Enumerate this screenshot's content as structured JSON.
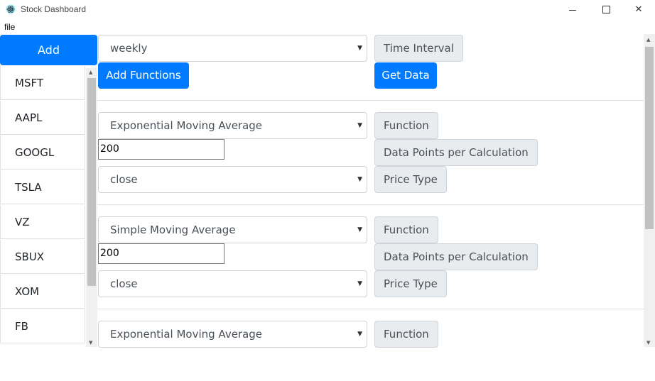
{
  "window": {
    "title": "Stock Dashboard",
    "icon": "electron-atom-icon",
    "min_glyph": "",
    "close_glyph": "✕"
  },
  "menu": {
    "file": "file"
  },
  "sidebar": {
    "add_label": "Add",
    "tickers": [
      "MSFT",
      "AAPL",
      "GOOGL",
      "TSLA",
      "VZ",
      "SBUX",
      "XOM",
      "FB"
    ]
  },
  "header": {
    "interval_value": "weekly",
    "interval_label": "Time Interval",
    "add_functions_label": "Add Functions",
    "get_data_label": "Get Data"
  },
  "functions": [
    {
      "function_value": "Exponential Moving Average",
      "function_label": "Function",
      "points_value": "200",
      "points_label": "Data Points per Calculation",
      "price_value": "close",
      "price_label": "Price Type"
    },
    {
      "function_value": "Simple Moving Average",
      "function_label": "Function",
      "points_value": "200",
      "points_label": "Data Points per Calculation",
      "price_value": "close",
      "price_label": "Price Type"
    },
    {
      "function_value": "Exponential Moving Average",
      "function_label": "Function"
    }
  ],
  "colors": {
    "primary": "#007bff",
    "label_bg": "#e9ecef",
    "border": "#ced4da"
  }
}
